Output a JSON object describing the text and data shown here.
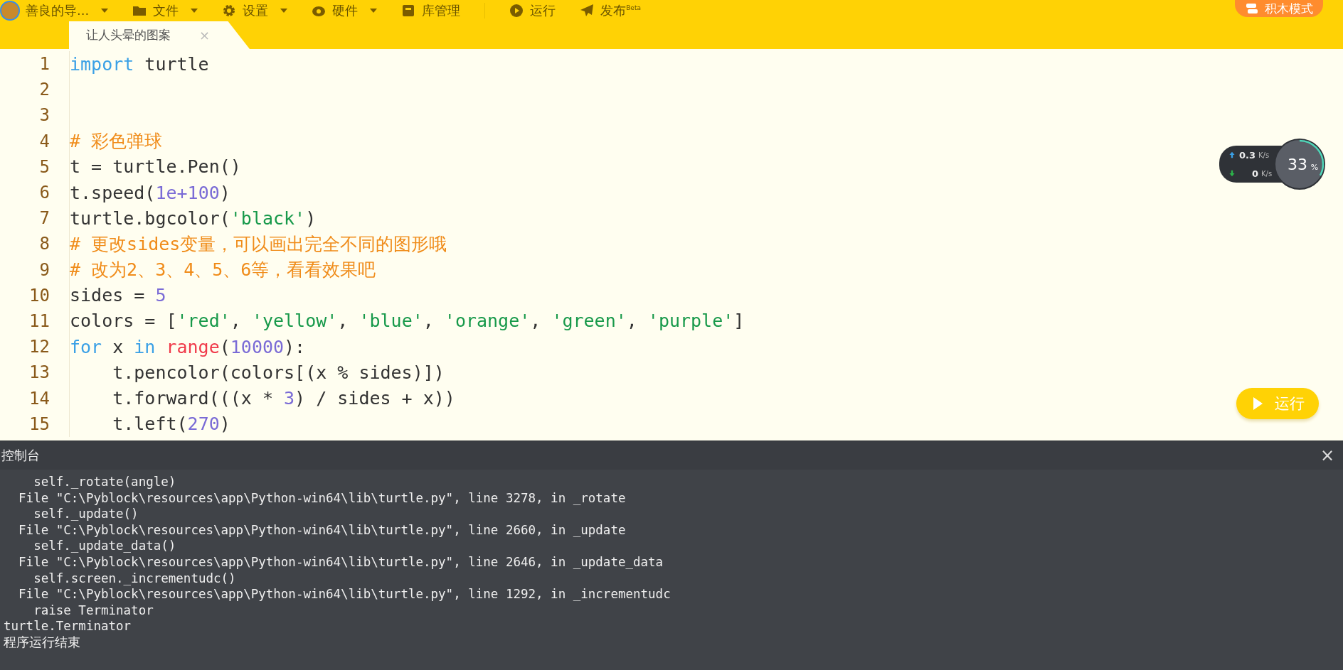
{
  "menu": {
    "project": "善良的导...",
    "items": [
      {
        "kind": "folder",
        "label": "文件",
        "dropdown": true
      },
      {
        "kind": "gear",
        "label": "设置",
        "dropdown": true
      },
      {
        "kind": "hardware",
        "label": "硬件",
        "dropdown": true
      },
      {
        "kind": "library",
        "label": "库管理",
        "dropdown": false
      },
      {
        "kind": "play",
        "label": "运行",
        "dropdown": false
      },
      {
        "kind": "send",
        "label": "发布$^{Beta}$",
        "dropdown": false
      }
    ],
    "mode_button": "积木模式"
  },
  "tabs": [
    {
      "label": "让人头晕的图案",
      "selected": true,
      "close": "×"
    }
  ],
  "editor": {
    "lines": [
      {
        "number": "1",
        "tokens": [
          {
            "kind": "keyword",
            "text": "import"
          },
          {
            "kind": "plain",
            "text": " turtle"
          }
        ]
      },
      {
        "number": "2"
      },
      {
        "number": "3"
      },
      {
        "number": "4",
        "tokens": [
          {
            "kind": "comment",
            "text": "# 彩色弹球"
          }
        ]
      },
      {
        "number": "5",
        "tokens": [
          {
            "kind": "plain",
            "text": "t = turtle.Pen()"
          }
        ]
      },
      {
        "number": "6",
        "tokens": [
          {
            "kind": "plain",
            "text": "t.speed("
          },
          {
            "kind": "number",
            "text": "1e+100"
          },
          {
            "kind": "plain",
            "text": ")"
          }
        ]
      },
      {
        "number": "7",
        "tokens": [
          {
            "kind": "plain",
            "text": "turtle.bgcolor("
          },
          {
            "kind": "string",
            "text": "'black'"
          },
          {
            "kind": "plain",
            "text": ")"
          }
        ]
      },
      {
        "number": "8",
        "tokens": [
          {
            "kind": "comment",
            "text": "# 更改sides变量，可以画出完全不同的图形哦"
          }
        ]
      },
      {
        "number": "9",
        "tokens": [
          {
            "kind": "comment",
            "text": "# 改为2、3、4、5、6等，看看效果吧"
          }
        ]
      },
      {
        "number": "10",
        "tokens": [
          {
            "kind": "plain",
            "text": "sides = "
          },
          {
            "kind": "number",
            "text": "5"
          }
        ]
      },
      {
        "number": "11",
        "tokens": [
          {
            "kind": "plain",
            "text": "colors = ["
          },
          {
            "kind": "string",
            "text": "'red'"
          },
          {
            "kind": "plain",
            "text": ", "
          },
          {
            "kind": "string",
            "text": "'yellow'"
          },
          {
            "kind": "plain",
            "text": ", "
          },
          {
            "kind": "string",
            "text": "'blue'"
          },
          {
            "kind": "plain",
            "text": ", "
          },
          {
            "kind": "string",
            "text": "'orange'"
          },
          {
            "kind": "plain",
            "text": ", "
          },
          {
            "kind": "string",
            "text": "'green'"
          },
          {
            "kind": "plain",
            "text": ", "
          },
          {
            "kind": "string",
            "text": "'purple'"
          },
          {
            "kind": "plain",
            "text": "]"
          }
        ]
      },
      {
        "number": "12",
        "tokens": [
          {
            "kind": "keyword",
            "text": "for"
          },
          {
            "kind": "plain",
            "text": " x "
          },
          {
            "kind": "keyword",
            "text": "in "
          },
          {
            "kind": "builtin",
            "text": "range"
          },
          {
            "kind": "plain",
            "text": "("
          },
          {
            "kind": "number",
            "text": "10000"
          },
          {
            "kind": "plain",
            "text": "):"
          }
        ]
      },
      {
        "number": "13",
        "tokens": [
          {
            "kind": "plain",
            "text": "    t.pencolor(colors[(x % sides)])"
          }
        ]
      },
      {
        "number": "14",
        "tokens": [
          {
            "kind": "plain",
            "text": "    t.forward(((x * "
          },
          {
            "kind": "number",
            "text": "3"
          },
          {
            "kind": "plain",
            "text": ") / sides + x))"
          }
        ]
      },
      {
        "number": "15",
        "tokens": [
          {
            "kind": "plain",
            "text": "    t.left("
          },
          {
            "kind": "number",
            "text": "270"
          },
          {
            "kind": "plain",
            "text": ")"
          }
        ]
      }
    ]
  },
  "network": {
    "upload": "0.3",
    "upload_unit": "K/s",
    "download": "0",
    "download_unit": "K/s",
    "usage": "33",
    "usage_unit": "%",
    "level": 0.33
  },
  "run_button": "运行",
  "console": {
    "title": "控制台",
    "close": "×",
    "lines": [
      "    self._rotate(angle)",
      "  File \"C:\\Pyblock\\resources\\app\\Python-win64\\lib\\turtle.py\", line 3278, in _rotate",
      "    self._update()",
      "  File \"C:\\Pyblock\\resources\\app\\Python-win64\\lib\\turtle.py\", line 2660, in _update",
      "    self._update_data()",
      "  File \"C:\\Pyblock\\resources\\app\\Python-win64\\lib\\turtle.py\", line 2646, in _update_data",
      "    self.screen._incrementudc()",
      "  File \"C:\\Pyblock\\resources\\app\\Python-win64\\lib\\turtle.py\", line 1292, in _incrementudc",
      "    raise Terminator",
      "turtle.Terminator",
      "程序运行结束"
    ]
  }
}
